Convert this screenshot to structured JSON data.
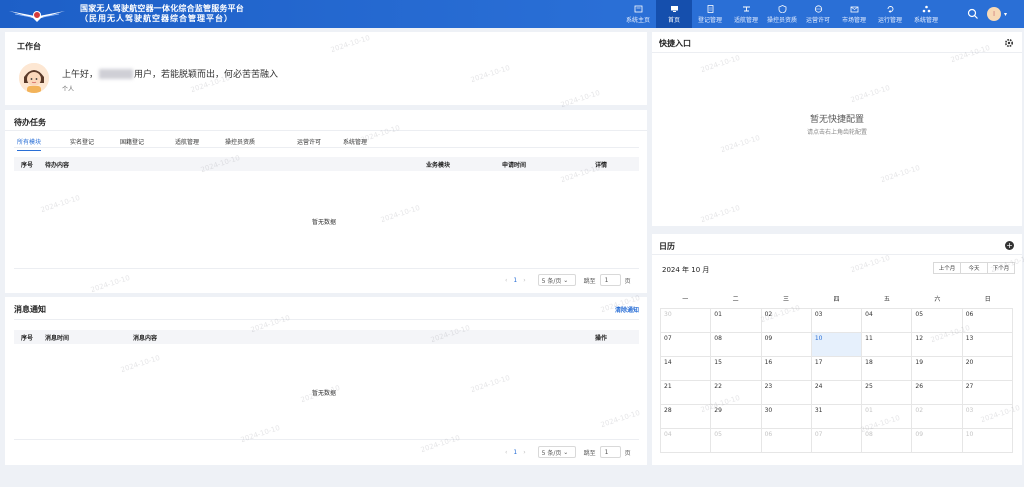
{
  "header": {
    "title_line1": "国家无人驾驶航空器一体化综合监管服务平台",
    "title_line2": "（民用无人驾驶航空器综合管理平台）",
    "nav": [
      {
        "label": "系统主页",
        "icon": "home-icon"
      },
      {
        "label": "首页",
        "icon": "monitor-icon",
        "active": true
      },
      {
        "label": "登记管理",
        "icon": "document-icon"
      },
      {
        "label": "适航管理",
        "icon": "drone-icon"
      },
      {
        "label": "操控员资质",
        "icon": "shield-icon"
      },
      {
        "label": "运营许可",
        "icon": "globe-icon"
      },
      {
        "label": "市场管理",
        "icon": "market-icon"
      },
      {
        "label": "运行管理",
        "icon": "cycle-icon"
      },
      {
        "label": "系统管理",
        "icon": "cluster-icon"
      }
    ],
    "user_initial": "I"
  },
  "workbench": {
    "title": "工作台",
    "greeting_prefix": "上午好，",
    "greeting_suffix": "用户，若能脱颖而出，何必苦苦融入",
    "role": "个人"
  },
  "todo": {
    "title": "待办任务",
    "tabs": [
      "所有模块",
      "实名登记",
      "国籍登记",
      "适航管理",
      "操控员资质",
      "运营许可",
      "系统管理"
    ],
    "columns": {
      "index": "序号",
      "content": "待办内容",
      "module": "业务模块",
      "time": "申请时间",
      "detail": "详情"
    },
    "empty": "暂无数据",
    "pager": {
      "current": "1",
      "page_size": "5 条/页",
      "jump_label": "跳至",
      "jump_value": "1",
      "page_unit": "页"
    }
  },
  "notice": {
    "title": "消息通知",
    "clear": "清除通知",
    "columns": {
      "index": "序号",
      "time": "消息时间",
      "content": "消息内容",
      "action": "操作"
    },
    "empty": "暂无数据",
    "pager": {
      "current": "1",
      "page_size": "5 条/页",
      "jump_label": "跳至",
      "jump_value": "1",
      "page_unit": "页"
    }
  },
  "quick": {
    "title": "快捷入口",
    "empty_title": "暂无快捷配置",
    "empty_hint": "请点击右上角齿轮配置"
  },
  "calendar": {
    "title": "日历",
    "month": "2024 年 10 月",
    "buttons": [
      "上个月",
      "今天",
      "下个月"
    ],
    "weekdays": [
      "一",
      "二",
      "三",
      "四",
      "五",
      "六",
      "日"
    ],
    "days": [
      {
        "d": "30",
        "o": true
      },
      {
        "d": "01"
      },
      {
        "d": "02"
      },
      {
        "d": "03"
      },
      {
        "d": "04"
      },
      {
        "d": "05"
      },
      {
        "d": "06"
      },
      {
        "d": "07"
      },
      {
        "d": "08"
      },
      {
        "d": "09"
      },
      {
        "d": "10",
        "t": true
      },
      {
        "d": "11"
      },
      {
        "d": "12"
      },
      {
        "d": "13"
      },
      {
        "d": "14"
      },
      {
        "d": "15"
      },
      {
        "d": "16"
      },
      {
        "d": "17"
      },
      {
        "d": "18"
      },
      {
        "d": "19"
      },
      {
        "d": "20"
      },
      {
        "d": "21"
      },
      {
        "d": "22"
      },
      {
        "d": "23"
      },
      {
        "d": "24"
      },
      {
        "d": "25"
      },
      {
        "d": "26"
      },
      {
        "d": "27"
      },
      {
        "d": "28"
      },
      {
        "d": "29"
      },
      {
        "d": "30"
      },
      {
        "d": "31"
      },
      {
        "d": "01",
        "o": true
      },
      {
        "d": "02",
        "o": true
      },
      {
        "d": "03",
        "o": true
      },
      {
        "d": "04",
        "o": true
      },
      {
        "d": "05",
        "o": true
      },
      {
        "d": "06",
        "o": true
      },
      {
        "d": "07",
        "o": true
      },
      {
        "d": "08",
        "o": true
      },
      {
        "d": "09",
        "o": true
      },
      {
        "d": "10",
        "o": true
      }
    ]
  },
  "watermark": "2024-10-10",
  "colors": {
    "primary": "#2a6fd6",
    "header": "#1d5fc7",
    "active_nav": "#154fad"
  }
}
